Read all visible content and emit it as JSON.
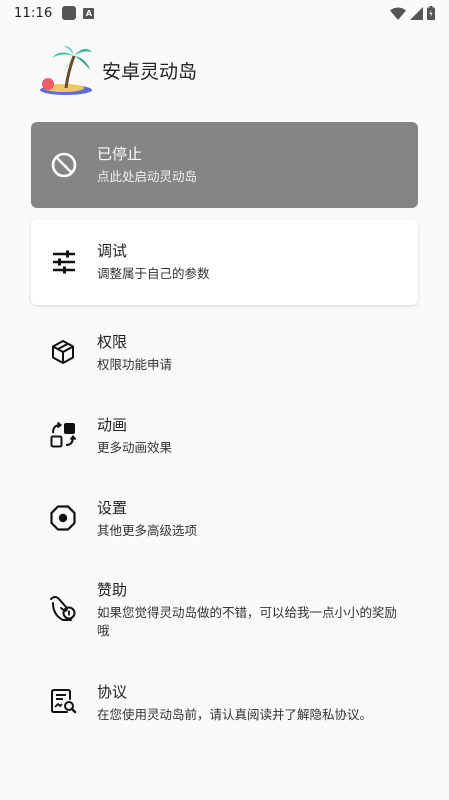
{
  "status_bar": {
    "time": "11:16",
    "icons": [
      "notification-square-icon",
      "a-icon",
      "wifi-icon",
      "signal-icon",
      "battery-icon"
    ],
    "a_glyph": "A"
  },
  "app": {
    "title": "安卓灵动岛",
    "logo_icon": "palm-island-logo"
  },
  "status_card": {
    "title": "已停止",
    "subtitle": "点此处启动灵动岛",
    "icon": "block-icon",
    "color": "#858585"
  },
  "debug_card": {
    "title": "调试",
    "subtitle": "调整属于自己的参数",
    "icon": "sliders-icon"
  },
  "menu": [
    {
      "title": "权限",
      "subtitle": "权限功能申请",
      "icon": "cube-icon"
    },
    {
      "title": "动画",
      "subtitle": "更多动画效果",
      "icon": "shapes-swap-icon"
    },
    {
      "title": "设置",
      "subtitle": "其他更多高级选项",
      "icon": "octagon-icon"
    },
    {
      "title": "赞助",
      "subtitle": "如果您觉得灵动岛做的不错，可以给我一点小小的奖励哦",
      "icon": "hand-coin-icon"
    },
    {
      "title": "协议",
      "subtitle": "在您使用灵动岛前，请认真阅读并了解隐私协议。",
      "icon": "document-search-icon"
    }
  ]
}
